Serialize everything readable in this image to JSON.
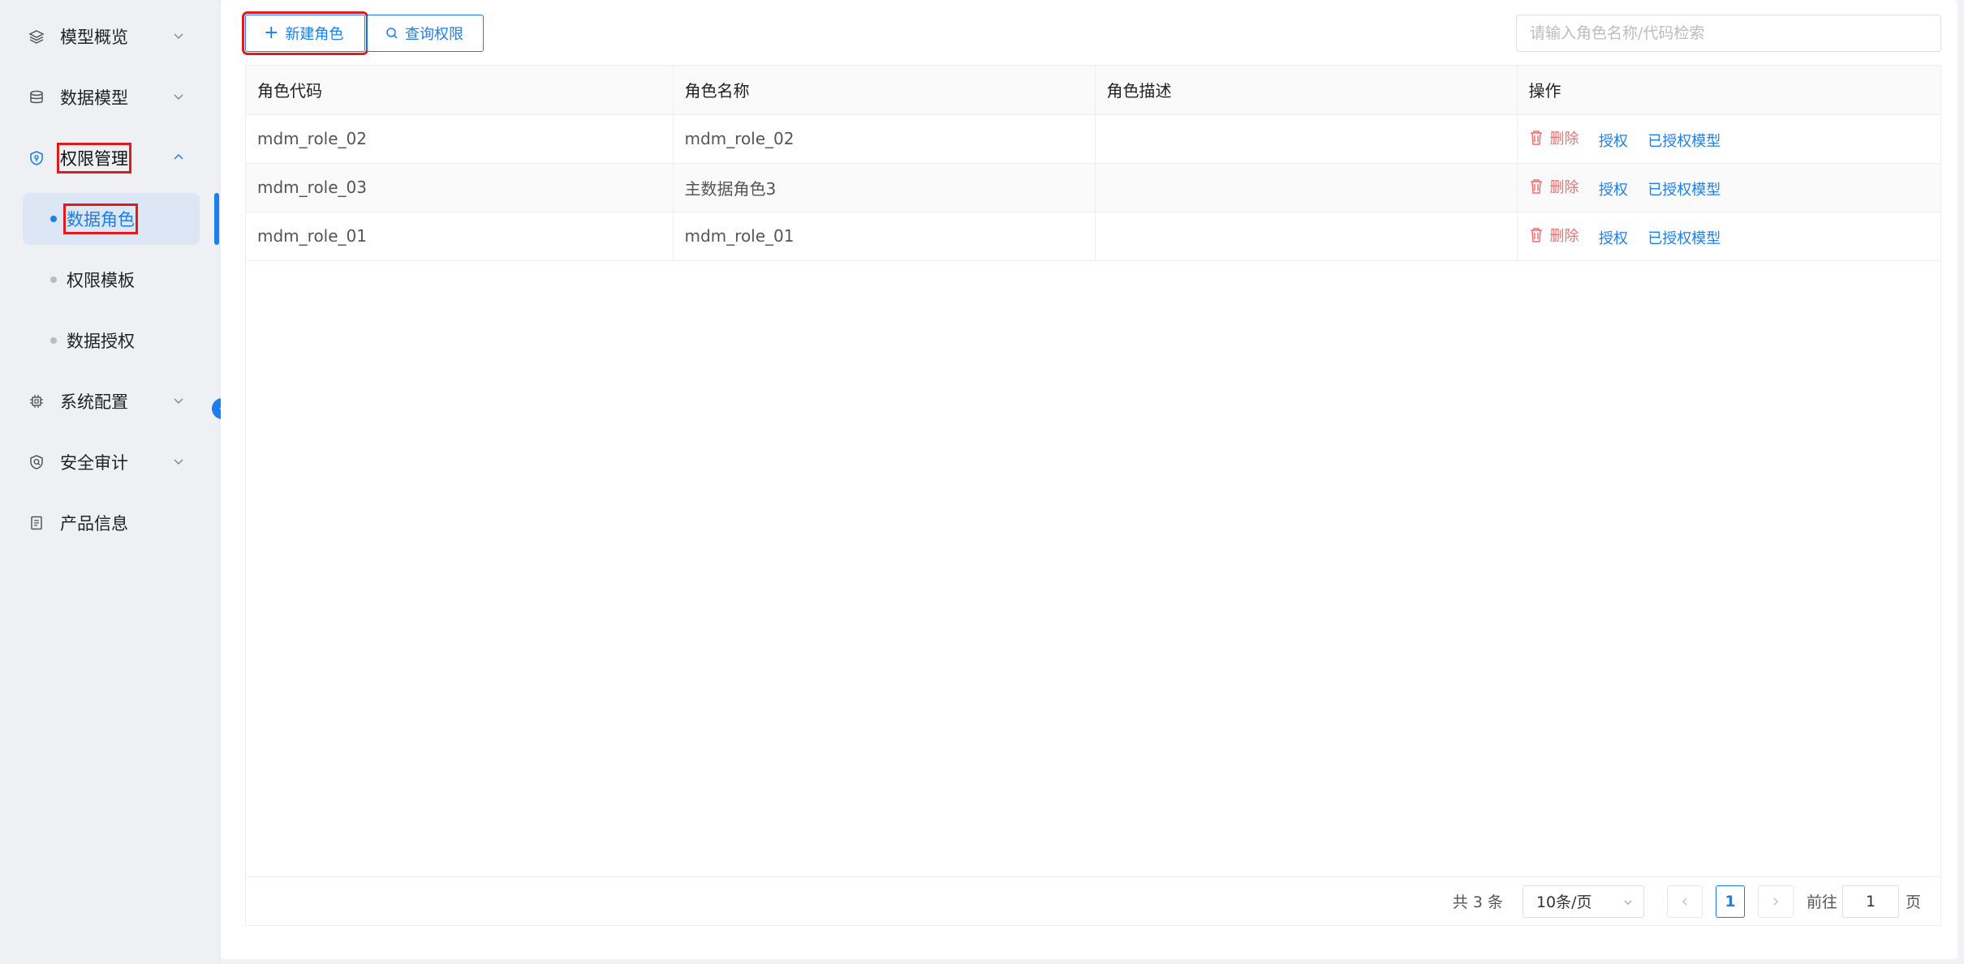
{
  "sidebar": {
    "items": [
      {
        "label": "模型概览",
        "icon": "layers-icon"
      },
      {
        "label": "数据模型",
        "icon": "database-icon"
      },
      {
        "label": "权限管理",
        "icon": "shield-icon"
      },
      {
        "label": "系统配置",
        "icon": "chip-icon"
      },
      {
        "label": "安全审计",
        "icon": "audit-icon"
      },
      {
        "label": "产品信息",
        "icon": "document-icon"
      }
    ],
    "sub_items": [
      {
        "label": "数据角色"
      },
      {
        "label": "权限模板"
      },
      {
        "label": "数据授权"
      }
    ]
  },
  "toolbar": {
    "new_role": "新建角色",
    "query_perm": "查询权限",
    "search_placeholder": "请输入角色名称/代码检索"
  },
  "table": {
    "headers": [
      "角色代码",
      "角色名称",
      "角色描述",
      "操作"
    ],
    "rows": [
      {
        "code": "mdm_role_02",
        "name": "mdm_role_02",
        "desc": ""
      },
      {
        "code": "mdm_role_03",
        "name": "主数据角色3",
        "desc": ""
      },
      {
        "code": "mdm_role_01",
        "name": "mdm_role_01",
        "desc": ""
      }
    ],
    "actions": {
      "delete": "删除",
      "authorize": "授权",
      "authorized_models": "已授权模型"
    }
  },
  "pagination": {
    "total": "共 3 条",
    "page_size": "10条/页",
    "current_page": "1",
    "goto_label": "前往",
    "goto_value": "1",
    "page_suffix": "页"
  },
  "colors": {
    "accent": "#1a7ff0",
    "danger": "#f56c6c",
    "highlight": "#e01b1b"
  }
}
